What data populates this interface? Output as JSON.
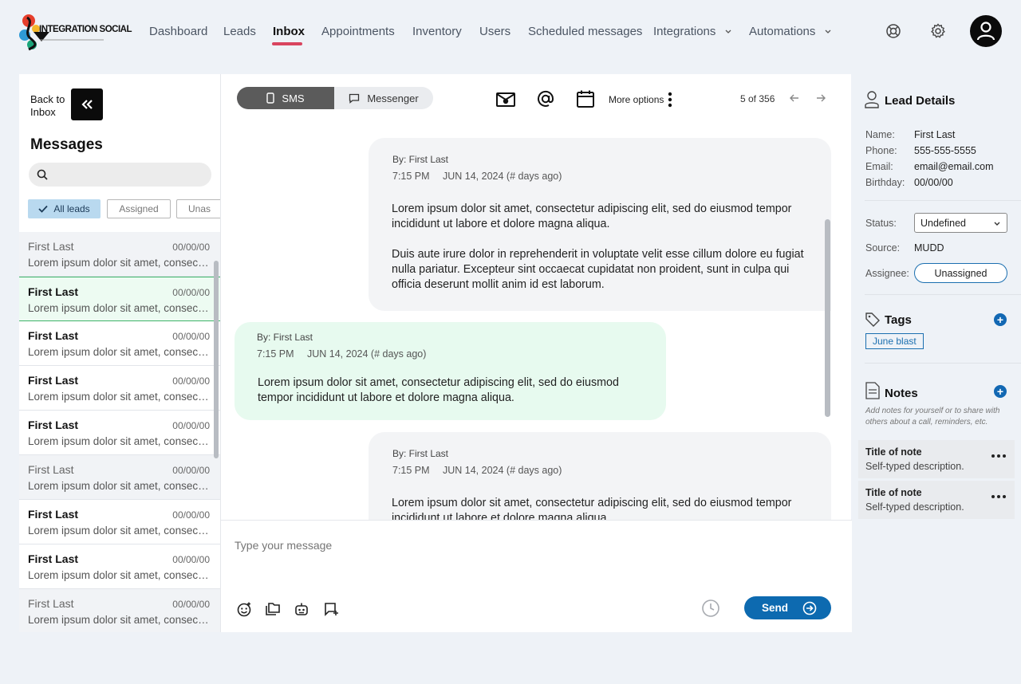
{
  "brand": {
    "logo_text": "INTEGRATION SOCIAL"
  },
  "nav": {
    "items": [
      "Dashboard",
      "Leads",
      "Inbox",
      "Appointments",
      "Inventory",
      "Users",
      "Scheduled messages",
      "Integrations",
      "Automations"
    ],
    "active": "Inbox"
  },
  "header_icons": [
    "help-icon",
    "settings-icon",
    "user-avatar-icon"
  ],
  "sidebar": {
    "back_label": "Back to Inbox",
    "title": "Messages",
    "search_placeholder": "",
    "filters": [
      "All leads",
      "Assigned",
      "Unas"
    ],
    "rows": [
      {
        "name": "First Last",
        "date": "00/00/00",
        "preview": "Lorem ipsum dolor sit amet, consectetur adipiscing",
        "state": "read"
      },
      {
        "name": "First Last",
        "date": "00/00/00",
        "preview": "Lorem ipsum dolor sit amet, consectetur adipiscing",
        "state": "selected"
      },
      {
        "name": "First Last",
        "date": "00/00/00",
        "preview": "Lorem ipsum dolor sit amet, consectetur adipiscing",
        "state": "unread"
      },
      {
        "name": "First Last",
        "date": "00/00/00",
        "preview": "Lorem ipsum dolor sit amet, consectetur adipiscing",
        "state": "unread"
      },
      {
        "name": "First Last",
        "date": "00/00/00",
        "preview": "Lorem ipsum dolor sit amet, consectetur adipiscing",
        "state": "unread"
      },
      {
        "name": "First Last",
        "date": "00/00/00",
        "preview": "Lorem ipsum dolor sit amet, consectetur adipiscing",
        "state": "read"
      },
      {
        "name": "First Last",
        "date": "00/00/00",
        "preview": "Lorem ipsum dolor sit amet, consectetur adipiscing",
        "state": "unread"
      },
      {
        "name": "First Last",
        "date": "00/00/00",
        "preview": "Lorem ipsum dolor sit amet, consectetur adipiscing",
        "state": "unread"
      },
      {
        "name": "First Last",
        "date": "00/00/00",
        "preview": "Lorem ipsum dolor sit amet, consectetur adipiscing",
        "state": "read"
      }
    ]
  },
  "conversation": {
    "channels": {
      "sms": "SMS",
      "messenger": "Messenger",
      "active": "SMS"
    },
    "toolbar_icons": [
      "mail-icon",
      "at-icon",
      "calendar-icon"
    ],
    "more_options": "More options",
    "pager": "5 of 356",
    "messages": [
      {
        "direction": "in",
        "by": "By: First Last",
        "time": "7:15 PM",
        "date": "JUN 14, 2024 (# days ago)",
        "text": "Lorem ipsum dolor sit amet, consectetur adipiscing elit, sed do eiusmod tempor incididunt ut labore et dolore magna aliqua.",
        "text2": "Duis aute irure dolor in reprehenderit in voluptate velit esse cillum dolore eu fugiat nulla pariatur. Excepteur sint occaecat cupidatat non proident, sunt in culpa qui officia deserunt mollit anim id est laborum."
      },
      {
        "direction": "out",
        "by": "By: First Last",
        "time": "7:15 PM",
        "date": "JUN 14, 2024 (# days ago)",
        "text": "Lorem ipsum dolor sit amet, consectetur adipiscing elit, sed do eiusmod tempor incididunt ut labore et dolore magna aliqua."
      },
      {
        "direction": "in",
        "by": "By: First Last",
        "time": "7:15 PM",
        "date": "JUN 14, 2024 (# days ago)",
        "text": "Lorem ipsum dolor sit amet, consectetur adipiscing elit, sed do eiusmod tempor incididunt ut labore et dolore magna aliqua."
      }
    ],
    "composer": {
      "placeholder": "Type your message",
      "icons": [
        "emoji-icon",
        "attachment-icon",
        "bot-icon",
        "template-icon",
        "schedule-clock-icon"
      ],
      "send": "Send"
    }
  },
  "lead": {
    "title": "Lead Details",
    "fields": [
      {
        "label": "Name:",
        "value": "First Last"
      },
      {
        "label": "Phone:",
        "value": "555-555-5555"
      },
      {
        "label": "Email:",
        "value": "email@email.com"
      },
      {
        "label": "Birthday:",
        "value": "00/00/00"
      }
    ],
    "status_label": "Status:",
    "status_value": "Undefined",
    "source_label": "Source:",
    "source_value": "MUDD",
    "assignee_label": "Assignee:",
    "assignee_value": "Unassigned",
    "tags_title": "Tags",
    "tags": [
      "June blast"
    ],
    "notes_title": "Notes",
    "notes_hint": "Add notes for yourself or to share with others about a call, reminders, etc.",
    "notes": [
      {
        "title": "Title of note",
        "desc": "Self-typed description."
      },
      {
        "title": "Title of note",
        "desc": "Self-typed description."
      }
    ]
  },
  "colors": {
    "accent": "#0d6ab0",
    "nav_active_underline": "#d9455f",
    "selected_row_border": "#3fb36a",
    "sent_bubble": "#e7faef",
    "received_bubble": "#f3f4f6"
  }
}
